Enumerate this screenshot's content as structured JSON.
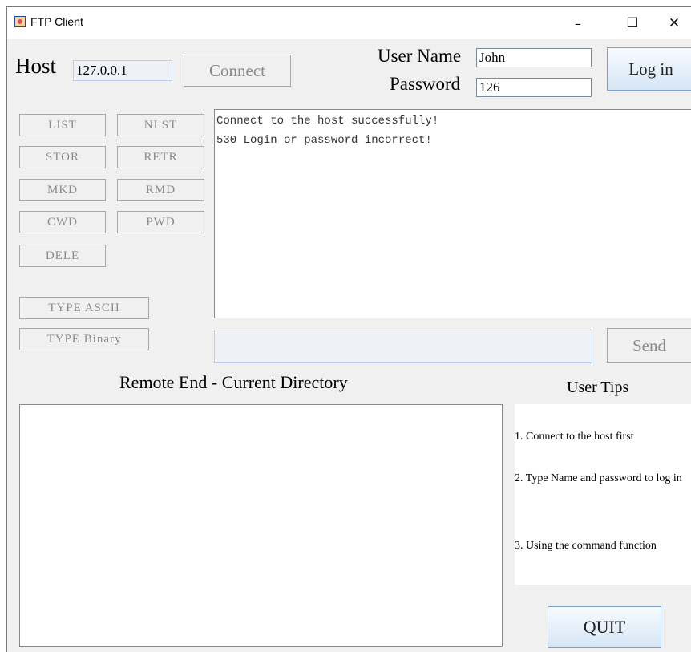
{
  "window": {
    "title": "FTP Client",
    "minimize": "–",
    "maximize": "☐",
    "close": "✕"
  },
  "connection": {
    "host_label": "Host",
    "host_value": "127.0.0.1",
    "connect_label": "Connect",
    "username_label": "User Name",
    "username_value": "John",
    "password_label": "Password",
    "password_value": "126",
    "login_label": "Log in"
  },
  "commands": {
    "list": "LIST",
    "nlst": "NLST",
    "stor": "STOR",
    "retr": "RETR",
    "mkd": "MKD",
    "rmd": "RMD",
    "cwd": "CWD",
    "pwd": "PWD",
    "dele": "DELE",
    "type_ascii": "TYPE ASCII",
    "type_binary": "TYPE Binary"
  },
  "log": {
    "lines": [
      "Connect to the host successfully!",
      "530 Login or password incorrect!"
    ]
  },
  "command_input": {
    "value": "",
    "send_label": "Send"
  },
  "remote": {
    "title": "Remote End - Current Directory"
  },
  "tips": {
    "title": "User Tips",
    "tip1": "1. Connect to the host first",
    "tip2": "2. Type Name and password to log in",
    "tip3": "3. Using the command function"
  },
  "quit_label": "QUIT"
}
